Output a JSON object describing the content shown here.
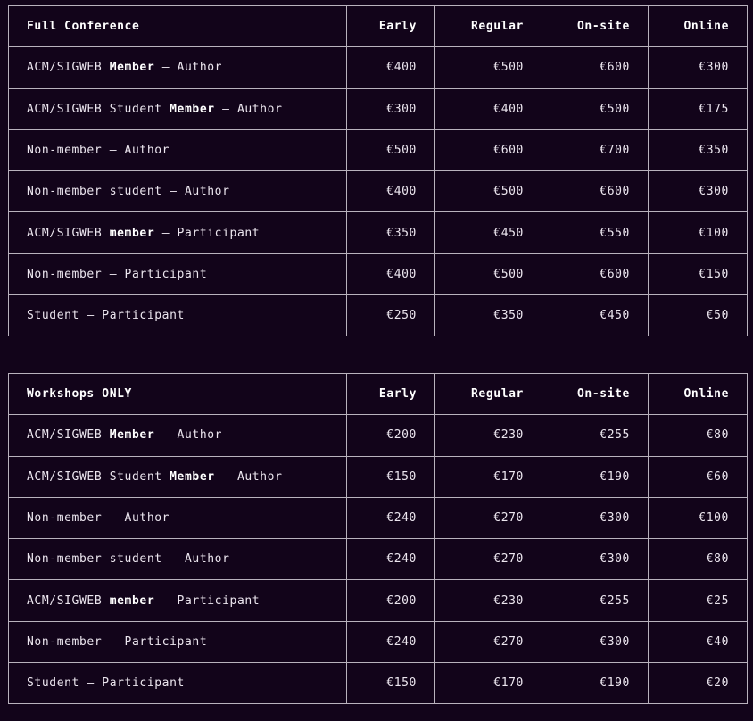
{
  "tables": [
    {
      "title": "Full Conference",
      "columns": [
        "Early",
        "Regular",
        "On-site",
        "Online"
      ],
      "rows": [
        {
          "pre": "ACM/SIGWEB ",
          "bold": "Member",
          "post": " – Author",
          "values": [
            "€400",
            "€500",
            "€600",
            "€300"
          ]
        },
        {
          "pre": "ACM/SIGWEB Student ",
          "bold": "Member",
          "post": " – Author",
          "values": [
            "€300",
            "€400",
            "€500",
            "€175"
          ]
        },
        {
          "pre": "Non-member – Author",
          "bold": "",
          "post": "",
          "values": [
            "€500",
            "€600",
            "€700",
            "€350"
          ]
        },
        {
          "pre": "Non-member student – Author",
          "bold": "",
          "post": "",
          "values": [
            "€400",
            "€500",
            "€600",
            "€300"
          ]
        },
        {
          "pre": "ACM/SIGWEB ",
          "bold": "member",
          "post": " – Participant",
          "values": [
            "€350",
            "€450",
            "€550",
            "€100"
          ]
        },
        {
          "pre": "Non-member – Participant",
          "bold": "",
          "post": "",
          "values": [
            "€400",
            "€500",
            "€600",
            "€150"
          ]
        },
        {
          "pre": "Student – Participant",
          "bold": "",
          "post": "",
          "values": [
            "€250",
            "€350",
            "€450",
            "€50"
          ]
        }
      ]
    },
    {
      "title": "Workshops ONLY",
      "columns": [
        "Early",
        "Regular",
        "On-site",
        "Online"
      ],
      "rows": [
        {
          "pre": "ACM/SIGWEB ",
          "bold": "Member",
          "post": " – Author",
          "values": [
            "€200",
            "€230",
            "€255",
            "€80"
          ]
        },
        {
          "pre": "ACM/SIGWEB Student ",
          "bold": "Member",
          "post": " – Author",
          "values": [
            "€150",
            "€170",
            "€190",
            "€60"
          ]
        },
        {
          "pre": "Non-member – Author",
          "bold": "",
          "post": "",
          "values": [
            "€240",
            "€270",
            "€300",
            "€100"
          ]
        },
        {
          "pre": "Non-member student – Author",
          "bold": "",
          "post": "",
          "values": [
            "€240",
            "€270",
            "€300",
            "€80"
          ]
        },
        {
          "pre": "ACM/SIGWEB ",
          "bold": "member",
          "post": " – Participant",
          "values": [
            "€200",
            "€230",
            "€255",
            "€25"
          ]
        },
        {
          "pre": "Non-member – Participant",
          "bold": "",
          "post": "",
          "values": [
            "€240",
            "€270",
            "€300",
            "€40"
          ]
        },
        {
          "pre": "Student – Participant",
          "bold": "",
          "post": "",
          "values": [
            "€150",
            "€170",
            "€190",
            "€20"
          ]
        }
      ]
    }
  ]
}
